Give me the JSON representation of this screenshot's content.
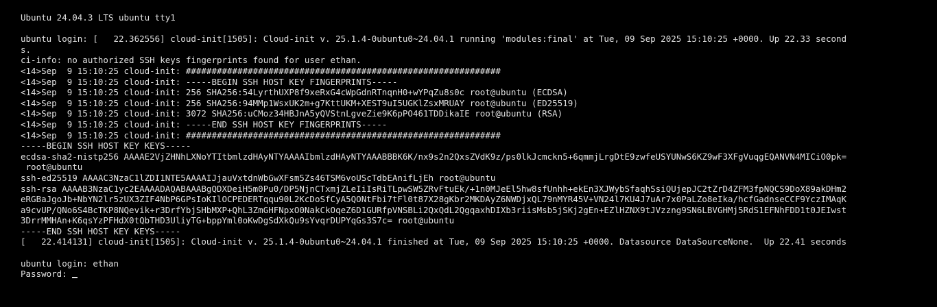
{
  "terminal": {
    "lines": [
      "Ubuntu 24.04.3 LTS ubuntu tty1",
      "",
      "ubuntu login: [   22.362556] cloud-init[1505]: Cloud-init v. 25.1.4-0ubuntu0~24.04.1 running 'modules:final' at Tue, 09 Sep 2025 15:10:25 +0000. Up 22.33 second",
      "s.",
      "ci-info: no authorized SSH keys fingerprints found for user ethan.",
      "<14>Sep  9 15:10:25 cloud-init: #############################################################",
      "<14>Sep  9 15:10:25 cloud-init: -----BEGIN SSH HOST KEY FINGERPRINTS-----",
      "<14>Sep  9 15:10:25 cloud-init: 256 SHA256:54LyrthUXP8f9xeRxG4cWpGdnRTnqnH0+wYPqZu8s0c root@ubuntu (ECDSA)",
      "<14>Sep  9 15:10:25 cloud-init: 256 SHA256:94MMp1WsxUK2m+g7KttUKM+XEST9uI5UGKlZsxMRUAY root@ubuntu (ED25519)",
      "<14>Sep  9 15:10:25 cloud-init: 3072 SHA256:uCMoz34HBJnA5yQVStnLgveZie9K6pPO461TDDikaIE root@ubuntu (RSA)",
      "<14>Sep  9 15:10:25 cloud-init: -----END SSH HOST KEY FINGERPRINTS-----",
      "<14>Sep  9 15:10:25 cloud-init: #############################################################",
      "-----BEGIN SSH HOST KEY KEYS-----",
      "ecdsa-sha2-nistp256 AAAAE2VjZHNhLXNoYTItbmlzdHAyNTYAAAAIbmlzdHAyNTYAAABBBK6K/nx9s2n2QxsZVdK9z/ps0lkJcmckn5+6qmmjLrgDtE9zwfeUSYUNwS6KZ9wF3XFgVuqgEQANVN4MICiO0pk=",
      " root@ubuntu",
      "ssh-ed25519 AAAAC3NzaC1lZDI1NTE5AAAAIJjauVxtdnWbGwXFsm5Zs46TSM6voUScTdbEAnifLjEh root@ubuntu",
      "ssh-rsa AAAAB3NzaC1yc2EAAAADAQABAAABgQDXDeiH5m0Pu0/DP5NjnCTxmjZLeIiIsRiTLpwSW5ZRvFtuEk/+1n0MJeEl5hw8sfUnhh+ekEn3XJWybSfaqhSsiQUjepJC2tZrD4ZFM3fpNQCS9DoX89akDHm2",
      "eRGBaJgoJb+NbYN2lr5zUX3ZIF4NbP6GPsIoKIlOCPEDERTqqu90L2KcDoSfCyA5QONtFbi7tFl0t87X28gKbr2MKDAyZ6NWDjxQL79nMYR45V+VN24l7KU4J7uAr7x0PaLZo8eIka/hcfGadnseCCF9YczIMAqK",
      "a9cvUP/QNo6S4BcTKP8NQevik+r3DrfYbjSHbMXP+QhL3ZmGHFNpxO0NakCkOqeZ6D1GURfpVNSBLi2QxQdL2QgqaxhDIXb3riisMsb5jSKj2gEn+EZlHZNX9tJVzzng9SN6LBVGHMj5RdS1EFNhFDD1t0JEIwst",
      "3DrrMMHAn+K6qsYzPFHdX0tQbTHD3UliyTG+bppYml0oKwDgSdXkQu9sYvqrDUPYqGs3S7c= root@ubuntu",
      "-----END SSH HOST KEY KEYS-----",
      "[   22.414131] cloud-init[1505]: Cloud-init v. 25.1.4-0ubuntu0~24.04.1 finished at Tue, 09 Sep 2025 15:10:25 +0000. Datasource DataSourceNone.  Up 22.41 seconds",
      "",
      "ubuntu login: ethan"
    ],
    "password_prompt": "Password: "
  }
}
